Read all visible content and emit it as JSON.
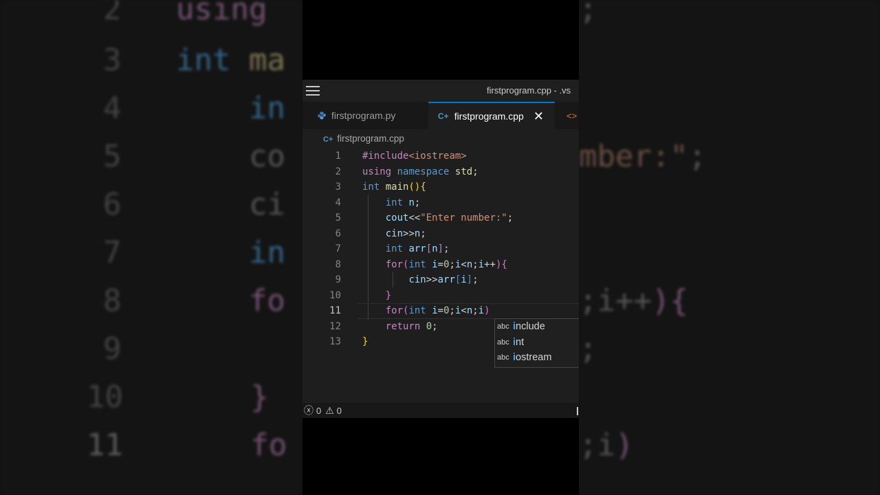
{
  "window": {
    "title": "firstprogram.cpp - .vs"
  },
  "tabs": [
    {
      "label": "firstprogram.py",
      "icon": "python-icon",
      "active": false
    },
    {
      "label": "firstprogram.cpp",
      "icon": "cpp-icon",
      "active": true,
      "close": "✕"
    },
    {
      "label": "<>",
      "icon": "html-icon",
      "active": false
    }
  ],
  "breadcrumb": {
    "file": "firstprogram.cpp"
  },
  "editor": {
    "active_line": 11,
    "line_numbers": [
      "1",
      "2",
      "3",
      "4",
      "5",
      "6",
      "7",
      "8",
      "9",
      "10",
      "11",
      "12",
      "13"
    ]
  },
  "suggest": {
    "items": [
      {
        "kind": "abc",
        "match": "i",
        "rest": "nclude"
      },
      {
        "kind": "abc",
        "match": "i",
        "rest": "nt"
      },
      {
        "kind": "abc",
        "match": "i",
        "rest": "ostream"
      }
    ]
  },
  "status": {
    "errors": "0",
    "warnings": "0"
  },
  "colors": {
    "accent": "#0078d4",
    "editor_bg": "#1e1e1e",
    "keyword": "#c586c0",
    "type": "#569cd6",
    "string": "#ce9178"
  }
}
